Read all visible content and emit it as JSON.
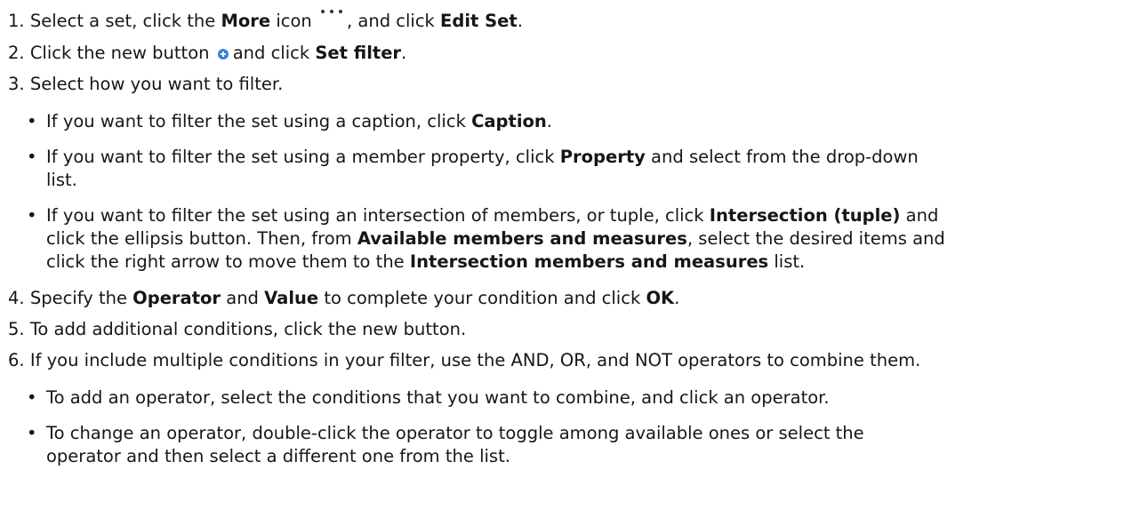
{
  "steps": [
    {
      "num": "1.",
      "t1": "Select a set, click the ",
      "b1": "More",
      "t2": " icon",
      "t3": ", and click ",
      "b2": "Edit Set",
      "t4": "."
    },
    {
      "num": "2.",
      "t1": "Click the new button",
      "t2": "and click ",
      "b1": "Set filter",
      "t3": "."
    },
    {
      "num": "3.",
      "t1": "Select how you want to filter."
    },
    {
      "num": "4.",
      "t1": "Specify the ",
      "b1": "Operator",
      "t2": " and ",
      "b2": "Value",
      "t3": " to complete your condition and click ",
      "b3": "OK",
      "t4": "."
    },
    {
      "num": "5.",
      "t1": "To add additional conditions, click the new button."
    },
    {
      "num": "6.",
      "t1": "If you include multiple conditions in your filter, use the AND, OR, and NOT operators to combine them."
    }
  ],
  "step3_bullets": [
    {
      "t1": "If you want to filter the set using a caption, click ",
      "b1": "Caption",
      "t2": "."
    },
    {
      "t1": "If you want to filter the set using a member property, click ",
      "b1": "Property",
      "t2": " and select from the drop-down",
      "cont": "list."
    },
    {
      "t1": "If you want to filter the set using an intersection of members, or tuple, click ",
      "b1": "Intersection (tuple)",
      "t2": " and",
      "c1": "click the ellipsis button. Then, from ",
      "cb1": "Available members and measures",
      "c2": ", select the desired items and",
      "c3": "click the right arrow to move them to the ",
      "cb2": "Intersection members and measures",
      "c4": " list."
    }
  ],
  "step6_bullets": [
    {
      "t1": "To add an operator, select the conditions that you want to combine, and click an operator."
    },
    {
      "t1": "To change an operator, double-click the operator to toggle among available ones or select the",
      "cont": "operator and then select a different one from the list."
    }
  ],
  "bullet_char": "•",
  "icons": {
    "more": "more-icon",
    "new": "new-button-icon",
    "new_color": "#3b7fe0"
  }
}
